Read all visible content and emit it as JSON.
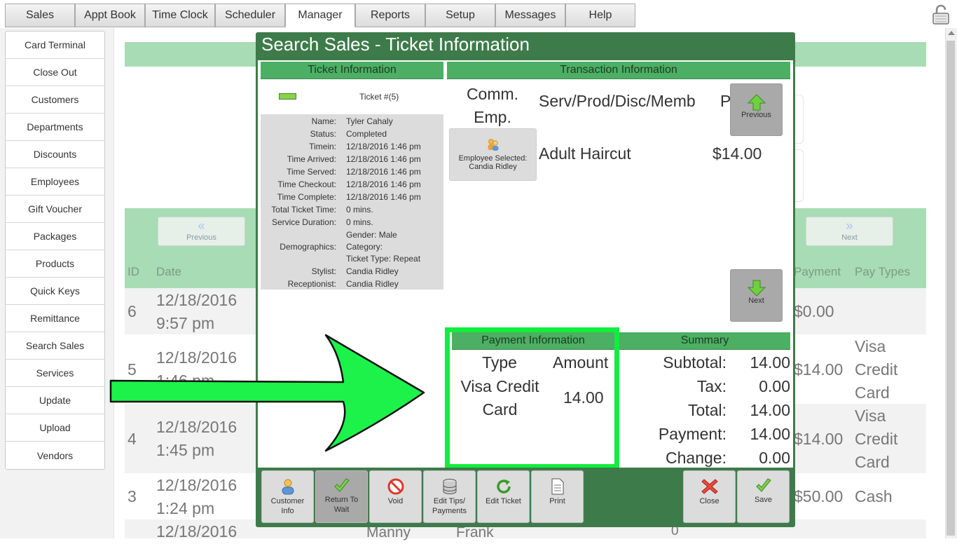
{
  "tabs": [
    "Sales",
    "Appt Book",
    "Time Clock",
    "Scheduler",
    "Manager",
    "Reports",
    "Setup",
    "Messages",
    "Help"
  ],
  "active_tab": "Manager",
  "menu": [
    "Card Terminal",
    "Close Out",
    "Customers",
    "Departments",
    "Discounts",
    "Employees",
    "Gift Voucher",
    "Packages",
    "Products",
    "Quick Keys",
    "Remittance",
    "Search Sales",
    "Services",
    "Update",
    "Upload",
    "Vendors"
  ],
  "background": {
    "prev_label": "Previous",
    "next_label": "Next",
    "columns": {
      "id": "ID",
      "date": "Date",
      "payment": "Payment",
      "pay_types": "Pay Types"
    },
    "rows": [
      {
        "id": "6",
        "date1": "12/18/2016",
        "date2": "9:57 pm",
        "payment": "$0.00",
        "pay1": "",
        "pay2": "",
        "pay3": ""
      },
      {
        "id": "5",
        "date1": "12/18/2016",
        "date2": "1:46 pm",
        "payment": "$14.00",
        "pay1": "Visa",
        "pay2": "Credit",
        "pay3": "Card"
      },
      {
        "id": "4",
        "date1": "12/18/2016",
        "date2": "1:45 pm",
        "payment": "$14.00",
        "pay1": "Visa",
        "pay2": "Credit",
        "pay3": "Card"
      },
      {
        "id": "3",
        "date1": "12/18/2016",
        "date2": "1:24 pm",
        "payment": "$50.00",
        "pay1": "Cash",
        "pay2": "",
        "pay3": ""
      }
    ],
    "partial_row": {
      "date": "12/18/2016",
      "a": "Manny",
      "b": "Frank",
      "c": "0"
    }
  },
  "modal": {
    "title": "Search Sales - Ticket Information",
    "ticket_info_header": "Ticket Information",
    "transaction_header": "Transaction Information",
    "ticket_number": "Ticket #(5)",
    "info_rows": [
      {
        "label": "Name:",
        "value": "Tyler Cahaly"
      },
      {
        "label": "Status:",
        "value": "Completed"
      },
      {
        "label": "Timein:",
        "value": "12/18/2016 1:46 pm"
      },
      {
        "label": "Time Arrived:",
        "value": "12/18/2016 1:46 pm"
      },
      {
        "label": "Time Served:",
        "value": "12/18/2016 1:46 pm"
      },
      {
        "label": "Time Checkout:",
        "value": "12/18/2016 1:46 pm"
      },
      {
        "label": "Time Complete:",
        "value": "12/18/2016 1:46 pm"
      },
      {
        "label": "Total Ticket Time:",
        "value": "0 mins."
      },
      {
        "label": "Service Duration:",
        "value": "0 mins."
      }
    ],
    "demographics_label": "Demographics:",
    "demographics": [
      "Gender: Male",
      "Category:",
      "Ticket Type: Repeat"
    ],
    "stylist_label": "Stylist:",
    "stylist": "Candia Ridley",
    "receptionist_label": "Receptionist:",
    "receptionist": "Candia Ridley",
    "comm_emp": [
      "Comm.",
      "Emp."
    ],
    "employee_selected": [
      "Employee Selected:",
      "Candia Ridley"
    ],
    "service_header": "Serv/Prod/Disc/Memb",
    "service_header_cut": "P",
    "service_name": "Adult Haircut",
    "service_price": "$14.00",
    "previous_label": "Previous",
    "next_label": "Next",
    "payment_header": "Payment Information",
    "summary_header": "Summary",
    "payment": {
      "type_label": "Type",
      "amount_label": "Amount",
      "type_lines": [
        "Visa Credit",
        "Card"
      ],
      "amount": "14.00"
    },
    "summary": [
      {
        "label": "Subtotal:",
        "value": "14.00"
      },
      {
        "label": "Tax:",
        "value": "0.00"
      },
      {
        "label": "Total:",
        "value": "14.00"
      },
      {
        "label": "Payment:",
        "value": "14.00"
      },
      {
        "label": "Change:",
        "value": "0.00"
      }
    ],
    "buttons": {
      "customer_info": [
        "Customer",
        "Info"
      ],
      "return_to_wait": [
        "Return To",
        "Wait"
      ],
      "void": "Void",
      "edit_tips": [
        "Edit Tips/",
        "Payments"
      ],
      "edit_ticket": "Edit Ticket",
      "print": "Print",
      "close": "Close",
      "save": "Save"
    }
  },
  "colors": {
    "highlight": "#11ee3c",
    "modal_green": "#3e7b4a",
    "header_green": "#4caf63"
  }
}
